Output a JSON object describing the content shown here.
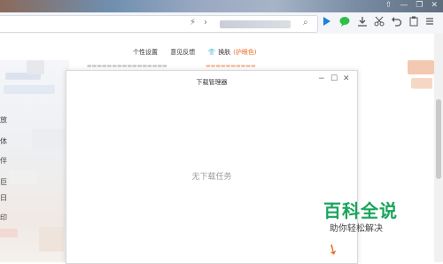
{
  "window_controls": [
    "⇧",
    "—",
    "❐",
    "✕"
  ],
  "toolbar": {
    "flash_icon": "⚡",
    "forward_icon": "›",
    "search_icon": "⌕",
    "icons": [
      "play-icon",
      "chat-icon",
      "download-icon",
      "scissors-icon",
      "undo-icon",
      "clipboard-icon",
      "menu-icon"
    ]
  },
  "page": {
    "links": [
      "个性设置",
      "意见反馈",
      "换肤",
      "(护眼色)"
    ],
    "left_chars": [
      "放",
      "体",
      "伴",
      "巨",
      "日",
      "印"
    ]
  },
  "dialog": {
    "title": "下载管理器",
    "empty_message": "无下载任务",
    "controls": [
      "−",
      "☐",
      "✕"
    ]
  },
  "watermark": {
    "title": "百科全说",
    "subtitle": "助你轻松解决"
  }
}
